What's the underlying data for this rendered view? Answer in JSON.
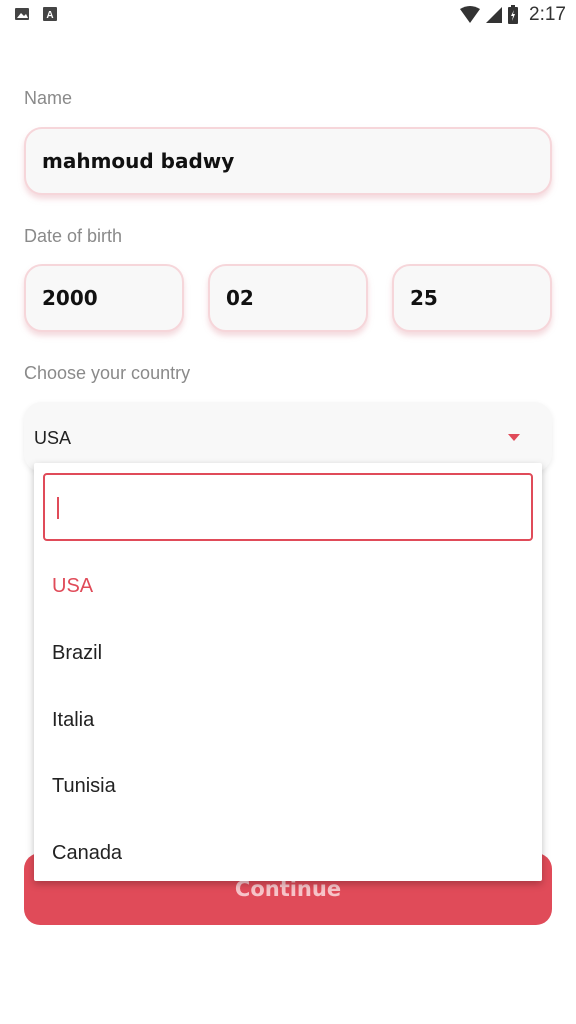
{
  "status_bar": {
    "time": "2:17",
    "left_icons": [
      "image-icon",
      "text-a-icon"
    ],
    "right_icons": [
      "wifi-icon",
      "signal-icon",
      "battery-icon"
    ]
  },
  "form": {
    "name_label": "Name",
    "name_value": "mahmoud badwy",
    "dob_label": "Date of birth",
    "dob_year": "2000",
    "dob_month": "02",
    "dob_day": "25",
    "country_label": "Choose your country",
    "country_selected": "USA"
  },
  "dropdown": {
    "search_value": "",
    "options": [
      "USA",
      "Brazil",
      "Italia",
      "Tunisia",
      "Canada"
    ],
    "selected_index": 0
  },
  "continue_label": "Continue",
  "colors": {
    "accent": "#e04b59",
    "card_bg": "#f8f8f8",
    "label": "#8a8a8a"
  }
}
